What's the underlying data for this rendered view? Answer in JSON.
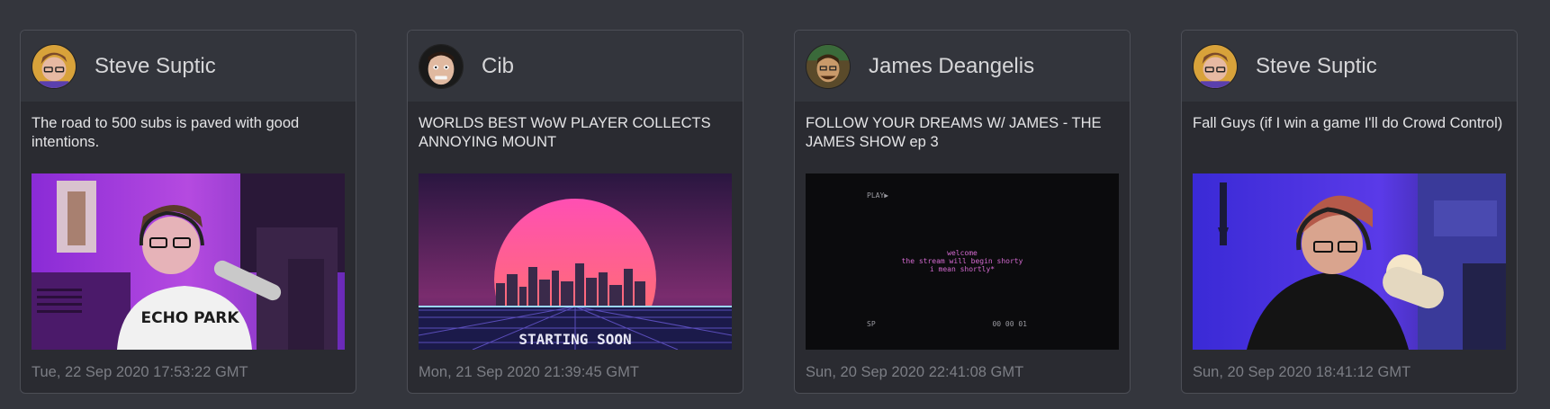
{
  "cards": [
    {
      "streamer": "Steve Suptic",
      "title": "The road to 500 subs is paved with good intentions.",
      "timestamp": "Tue, 22 Sep 2020 17:53:22 GMT",
      "thumb_shirt_text": "ECHO PARK"
    },
    {
      "streamer": "Cib",
      "title": "WORLDS BEST WoW PLAYER COLLECTS ANNOYING MOUNT",
      "timestamp": "Mon, 21 Sep 2020 21:39:45 GMT",
      "thumb_overlay_text": "STARTING SOON"
    },
    {
      "streamer": "James Deangelis",
      "title": "FOLLOW YOUR DREAMS W/ JAMES - THE JAMES SHOW ep 3",
      "timestamp": "Sun, 20 Sep 2020 22:41:08 GMT",
      "thumb_play_label": "PLAY▶",
      "thumb_line1": "welcome",
      "thumb_line2": "the stream will begin shorty",
      "thumb_line3": "i mean shortly*",
      "thumb_sp_label": "SP",
      "thumb_timecode": "00 00 01"
    },
    {
      "streamer": "Steve Suptic",
      "title": "Fall Guys (if I win a game I'll do Crowd Control)",
      "timestamp": "Sun, 20 Sep 2020 18:41:12 GMT"
    }
  ]
}
